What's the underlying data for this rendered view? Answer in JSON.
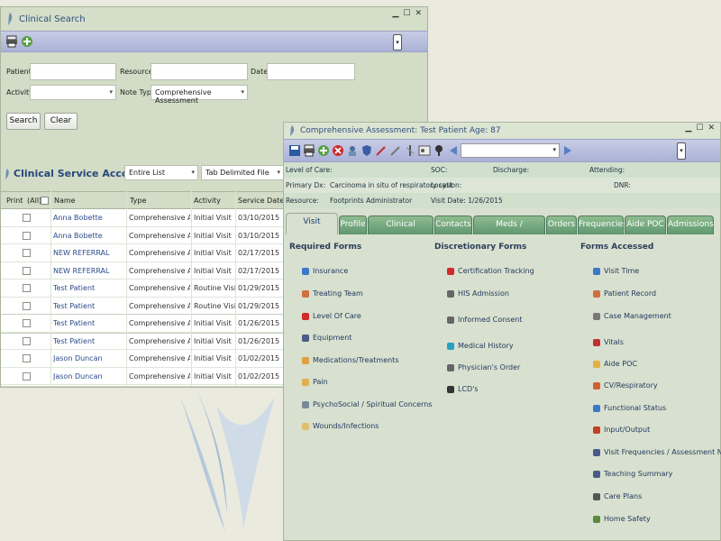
{
  "search_window": {
    "title": "Clinical Search",
    "labels": {
      "patient": "Patient",
      "resource": "Resource",
      "date": "Date",
      "activity": "Activity",
      "note_type": "Note Type"
    },
    "note_type_value": "Comprehensive Assessment",
    "buttons": {
      "search": "Search",
      "clear": "Clear"
    }
  },
  "service_list": {
    "title": "Clinical Service Account List",
    "filter_value": "Entire List",
    "export_value": "Tab Delimited File",
    "columns": {
      "print": "Print",
      "all": "(All)",
      "name": "Name",
      "type": "Type",
      "activity": "Activity",
      "service_date": "Service Date"
    },
    "rows": [
      {
        "name": "Anna Bobette",
        "type": "Comprehensive Assessment",
        "activity": "Initial Visit",
        "date": "03/10/2015"
      },
      {
        "name": "Anna Bobette",
        "type": "Comprehensive Assessment",
        "activity": "Initial Visit",
        "date": "03/10/2015"
      },
      {
        "name": "NEW REFERRAL",
        "type": "Comprehensive Assessment",
        "activity": "Initial Visit",
        "date": "02/17/2015"
      },
      {
        "name": "NEW REFERRAL",
        "type": "Comprehensive Assessment",
        "activity": "Initial Visit",
        "date": "02/17/2015"
      },
      {
        "name": "Test Patient",
        "type": "Comprehensive Assessment",
        "activity": "Routine Visit",
        "date": "01/29/2015"
      },
      {
        "name": "Test Patient",
        "type": "Comprehensive Assessment",
        "activity": "Routine Visit",
        "date": "01/29/2015"
      },
      {
        "name": "Test Patient",
        "type": "Comprehensive Assessment",
        "activity": "Initial Visit",
        "date": "01/26/2015"
      },
      {
        "name": "Test Patient",
        "type": "Comprehensive Assessment",
        "activity": "Initial Visit",
        "date": "01/26/2015"
      },
      {
        "name": "Jason Duncan",
        "type": "Comprehensive Assessment",
        "activity": "Initial Visit",
        "date": "01/02/2015"
      },
      {
        "name": "Jason Duncan",
        "type": "Comprehensive Assessment",
        "activity": "Initial Visit",
        "date": "01/02/2015"
      }
    ]
  },
  "assessment_window": {
    "title": "Comprehensive Assessment:",
    "patient": "Test Patient",
    "age": "Age: 87",
    "info": {
      "level_of_care": "Level of Care:",
      "soc": "SOC:",
      "discharge": "Discharge:",
      "attending": "Attending:",
      "primary_dx_label": "Primary Dx:",
      "primary_dx_value": "Carcinoma in situ of respiratory syst",
      "location": "Location:",
      "dnr": "DNR:",
      "resource_label": "Resource:",
      "resource_value": "Footprints Administrator",
      "visit_date": "Visit Date: 1/26/2015"
    },
    "tabs": [
      "Visit Progress",
      "Profile",
      "Clinical Overview",
      "Contacts",
      "Meds / Treatments",
      "Orders",
      "Frequencies",
      "Aide POC",
      "Admissions"
    ],
    "required_forms_title": "Required Forms",
    "required_forms": [
      "Insurance",
      "Treating Team",
      "Level Of Care",
      "Equipment",
      "Medications/Treatments",
      "Pain",
      "PsychoSocial / Spiritual Concerns",
      "Wounds/Infections"
    ],
    "discretionary_forms_title": "Discretionary Forms",
    "discretionary_forms": [
      "Certification Tracking",
      "HIS Admission",
      "Informed Consent",
      "Medical History",
      "Physician's Order",
      "LCD's"
    ],
    "forms_accessed_title": "Forms Accessed",
    "forms_accessed": [
      "Visit Time",
      "Patient Record",
      "Case Management",
      "Vitals",
      "Aide POC",
      "CV/Respiratory",
      "Functional Status",
      "Input/Output",
      "Visit Frequencies / Assessment Needs",
      "Teaching Summary",
      "Care Plans",
      "Home Safety"
    ]
  },
  "colors": {
    "tab_green": "#5f9770",
    "toolbar_lavender": "#aab1d6",
    "link_blue": "#2b4a8a"
  }
}
